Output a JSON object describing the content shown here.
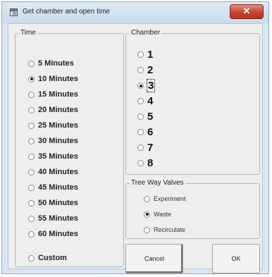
{
  "window": {
    "title": "Get chamber and open time",
    "close_label": "✕"
  },
  "time_group": {
    "label": "Time",
    "options": [
      {
        "label": "5 Minutes",
        "checked": false
      },
      {
        "label": "10 Minutes",
        "checked": true
      },
      {
        "label": "15 Minutes",
        "checked": false
      },
      {
        "label": "20 Minutes",
        "checked": false
      },
      {
        "label": "25 Minutes",
        "checked": false
      },
      {
        "label": "30 Minutes",
        "checked": false
      },
      {
        "label": "35 Minutes",
        "checked": false
      },
      {
        "label": "40 Minutes",
        "checked": false
      },
      {
        "label": "45 Minutes",
        "checked": false
      },
      {
        "label": "50 Minutes",
        "checked": false
      },
      {
        "label": "55 Minutes",
        "checked": false
      },
      {
        "label": "60 Minutes",
        "checked": false
      },
      {
        "label": "Custom",
        "checked": false
      }
    ]
  },
  "chamber_group": {
    "label": "Chamber",
    "options": [
      {
        "label": "1",
        "checked": false
      },
      {
        "label": "2",
        "checked": false
      },
      {
        "label": "3",
        "checked": true
      },
      {
        "label": "4",
        "checked": false
      },
      {
        "label": "5",
        "checked": false
      },
      {
        "label": "6",
        "checked": false
      },
      {
        "label": "7",
        "checked": false
      },
      {
        "label": "8",
        "checked": false
      }
    ]
  },
  "valves_group": {
    "label": "Tree Way Valves",
    "options": [
      {
        "label": "Experiment",
        "checked": false
      },
      {
        "label": "Waste",
        "checked": true
      },
      {
        "label": "Recirculate",
        "checked": false
      }
    ]
  },
  "buttons": {
    "cancel_label": "Cancel",
    "ok_label": "OK"
  }
}
